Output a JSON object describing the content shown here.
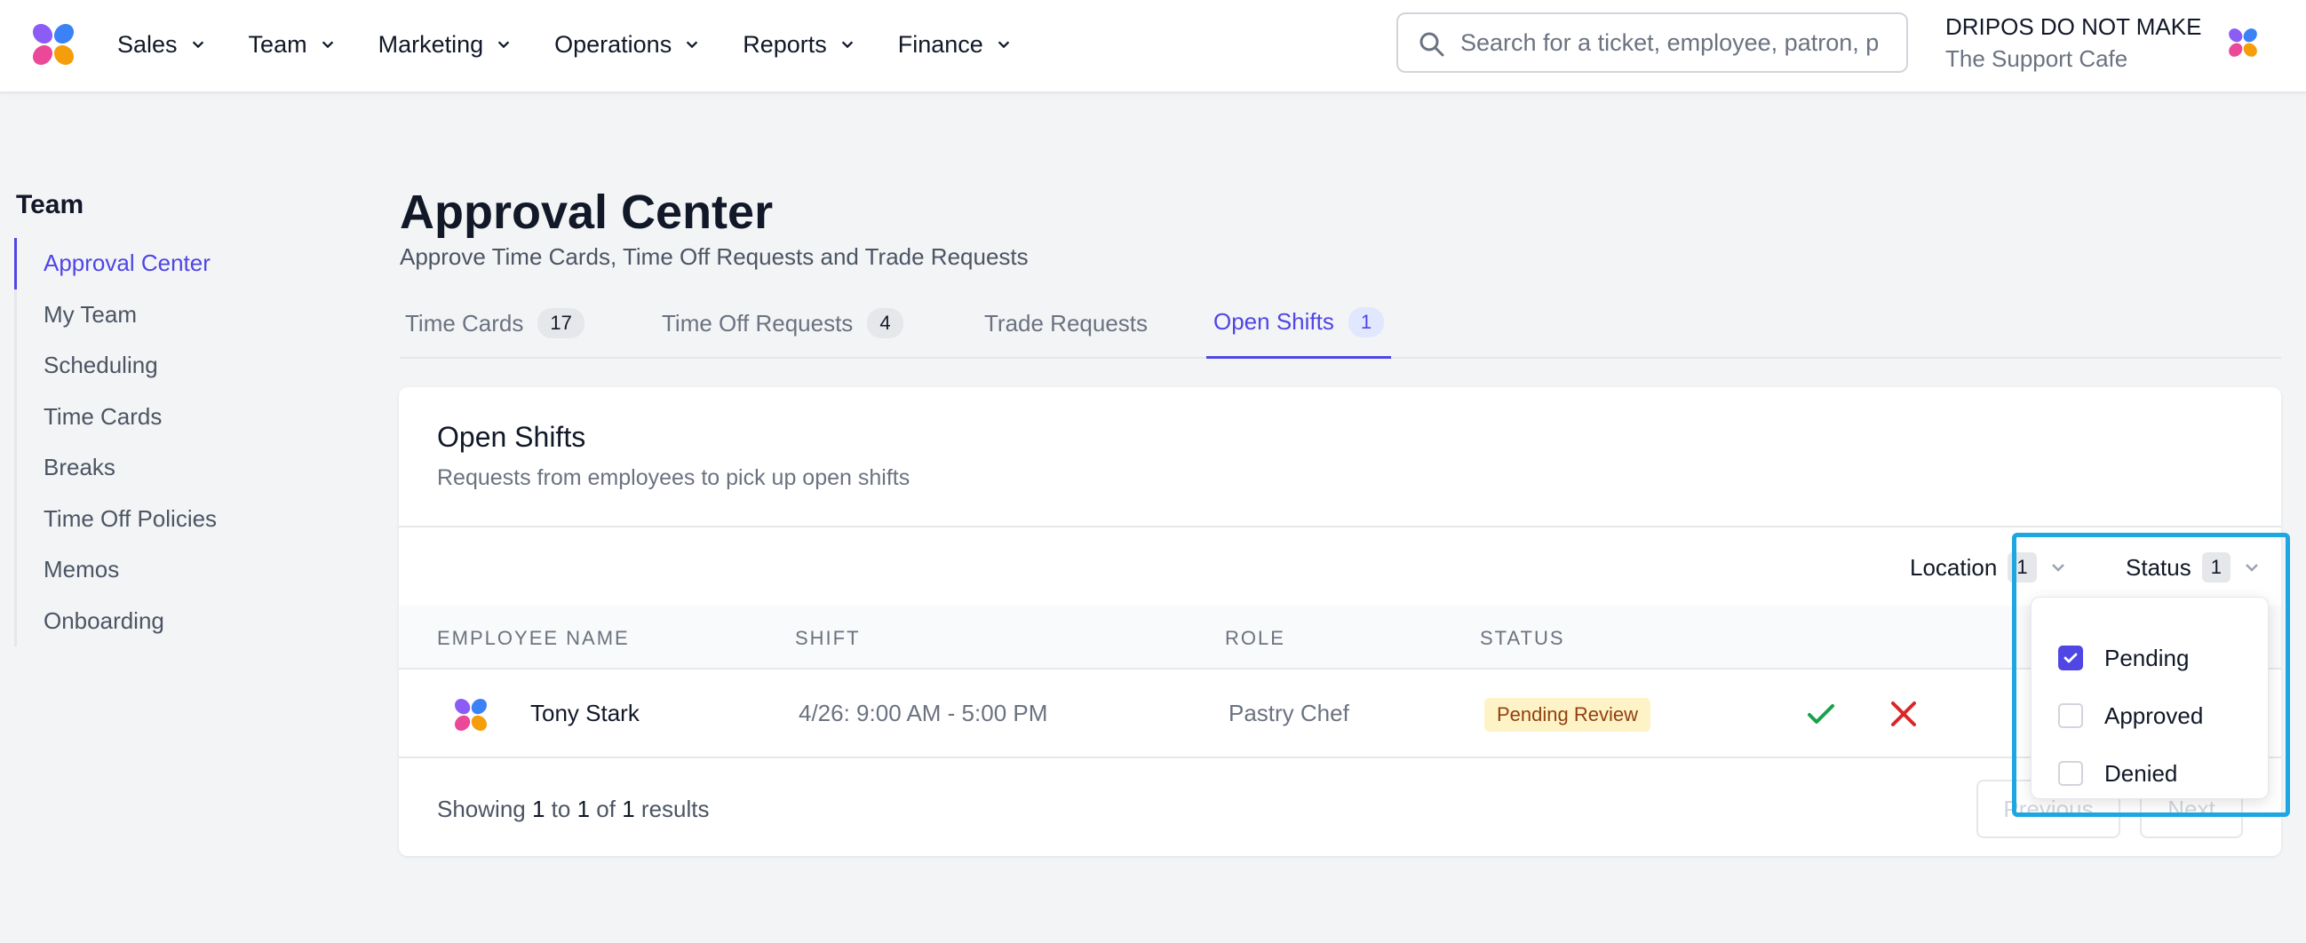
{
  "nav": {
    "menu": [
      {
        "label": "Sales"
      },
      {
        "label": "Team"
      },
      {
        "label": "Marketing"
      },
      {
        "label": "Operations"
      },
      {
        "label": "Reports"
      },
      {
        "label": "Finance"
      }
    ],
    "search_placeholder": "Search for a ticket, employee, patron, p",
    "account_name": "DRIPOS DO NOT MAKE",
    "account_location": "The Support Cafe"
  },
  "sidebar": {
    "title": "Team",
    "items": [
      {
        "label": "Approval Center",
        "active": true
      },
      {
        "label": "My Team"
      },
      {
        "label": "Scheduling"
      },
      {
        "label": "Time Cards"
      },
      {
        "label": "Breaks"
      },
      {
        "label": "Time Off Policies"
      },
      {
        "label": "Memos"
      },
      {
        "label": "Onboarding"
      }
    ]
  },
  "header": {
    "title": "Approval Center",
    "subtitle": "Approve Time Cards, Time Off Requests and Trade Requests"
  },
  "tabs": [
    {
      "label": "Time Cards",
      "count": "17"
    },
    {
      "label": "Time Off Requests",
      "count": "4"
    },
    {
      "label": "Trade Requests"
    },
    {
      "label": "Open Shifts",
      "count": "1",
      "active": true
    }
  ],
  "card": {
    "title": "Open Shifts",
    "subtitle": "Requests from employees to pick up open shifts",
    "filters": {
      "location": {
        "label": "Location",
        "count": "1"
      },
      "status": {
        "label": "Status",
        "count": "1"
      }
    },
    "columns": [
      "EMPLOYEE NAME",
      "SHIFT",
      "ROLE",
      "STATUS"
    ],
    "rows": [
      {
        "name": "Tony Stark",
        "shift": "4/26: 9:00 AM - 5:00 PM",
        "role": "Pastry Chef",
        "status": "Pending Review"
      }
    ],
    "footer": {
      "prefix": "Showing",
      "from": "1",
      "to_word": "to",
      "to": "1",
      "of_word": "of",
      "total": "1",
      "suffix": "results"
    },
    "pagination": {
      "previous": "Previous",
      "next": "Next"
    }
  },
  "status_dropdown": {
    "options": [
      {
        "label": "Pending",
        "checked": true
      },
      {
        "label": "Approved",
        "checked": false
      },
      {
        "label": "Denied",
        "checked": false
      }
    ]
  },
  "colors": {
    "accent": "#4f46e5",
    "highlight": "#1ea6e0",
    "approve": "#16a34a",
    "deny": "#dc2626",
    "pending_bg": "#fef3c7"
  },
  "icons": [
    "dripos-logo-icon",
    "chevron-down-icon",
    "search-icon",
    "check-icon",
    "x-icon"
  ]
}
